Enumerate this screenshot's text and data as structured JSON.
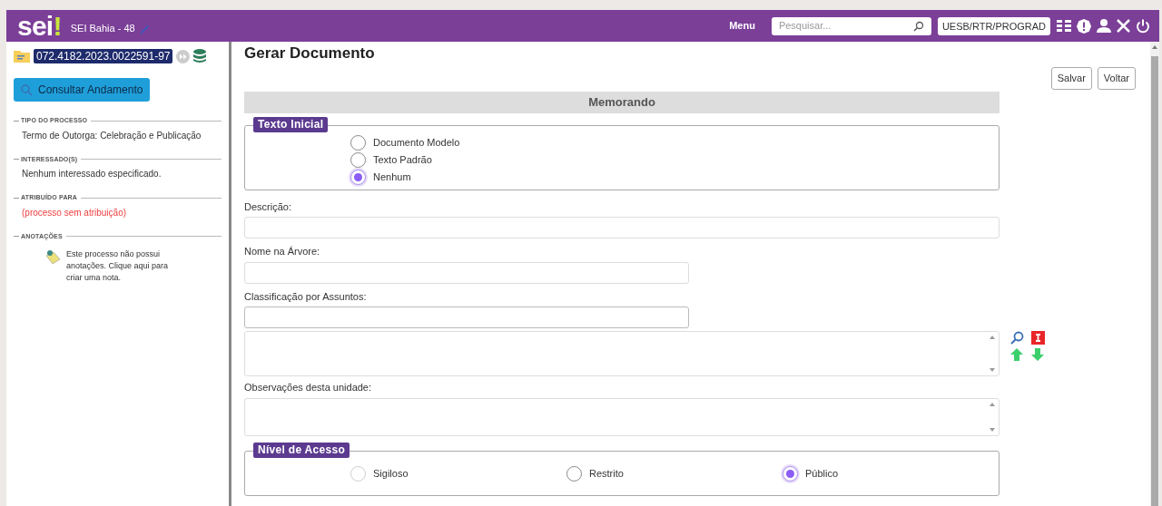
{
  "header": {
    "logo": "sei",
    "logo_mark": "!",
    "system": "SEI Bahia - 48",
    "menu": "Menu",
    "search": {
      "placeholder": "Pesquisar..."
    },
    "unit": "UESB/RTR/PROGRAD"
  },
  "sidebar": {
    "process_number": "072.4182.2023.0022591-97",
    "consult_button": "Consultar Andamento",
    "sections": [
      {
        "title": "TIPO DO PROCESSO",
        "text": "Termo de Outorga: Celebração e Publicação",
        "kind": "plain"
      },
      {
        "title": "INTERESSADO(S)",
        "text": "Nenhum interessado especificado.",
        "kind": "plain"
      },
      {
        "title": "ATRIBUÍDO PARA",
        "text": "(processo sem atribuição)",
        "kind": "alert"
      },
      {
        "title": "ANOTAÇÕES",
        "text": "Este processo não possui anotações. Clique aqui para criar uma nota.",
        "kind": "note"
      }
    ]
  },
  "page": {
    "title": "Gerar Documento",
    "buttons": [
      "Salvar",
      "Voltar"
    ],
    "document_type": "Memorando",
    "initial_text": {
      "legend": "Texto Inicial",
      "options": [
        {
          "label": "Documento Modelo",
          "selected": false
        },
        {
          "label": "Texto Padrão",
          "selected": false
        },
        {
          "label": "Nenhum",
          "selected": true
        }
      ]
    },
    "description_label": "Descrição:",
    "tree_name_label": "Nome na Árvore:",
    "classification_label": "Classificação por Assuntos:",
    "observations_label": "Observações desta unidade:",
    "access_level": {
      "legend": "Nível de Acesso",
      "options": [
        {
          "label": "Sigiloso",
          "selected": false
        },
        {
          "label": "Restrito",
          "selected": false
        },
        {
          "label": "Público",
          "selected": true
        }
      ]
    }
  }
}
